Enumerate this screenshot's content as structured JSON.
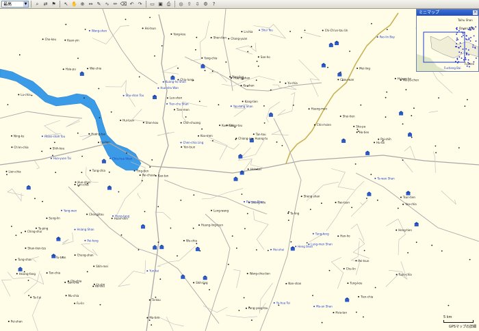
{
  "toolbar": {
    "zoom_select": "最高",
    "buttons": [
      "find-icon",
      "route-icon",
      "waypoint-icon",
      "select-icon",
      "pan-icon",
      "zoom-icon",
      "measure-icon",
      "draw-icon",
      "track-icon",
      "pencil-icon",
      "erase-icon",
      "undo-icon",
      "redo-icon",
      "folder-icon",
      "save-icon",
      "print-icon",
      "gps-icon",
      "upload-icon",
      "download-icon",
      "settings-icon",
      "help-icon"
    ]
  },
  "minimap": {
    "title": "ミニマップ",
    "close_label": "×",
    "labels": [
      "Taihu Shan",
      "Dayan Wan",
      "Fucheng Bai",
      "Fuzhen"
    ]
  },
  "scale": {
    "label": "5 km"
  },
  "detail": {
    "label": "GPSマップの詳細"
  },
  "colors": {
    "background": "#fffce8",
    "water": "#3b9be6",
    "road": "#a9a9a9",
    "highway": "#c8b254",
    "poi_blue": "#1e3cc8"
  },
  "map": {
    "black_labels": [
      "Chongjitou",
      "Hui-tsun",
      "Sheng-shan",
      "Shan-tien-tzu",
      "Chi-chia",
      "Huang-tu",
      "Chi-Ch'un-tzu Un",
      "Hsia-tan",
      "Huang-shan",
      "Hsiang-fang",
      "Pei-tsun",
      "Yu-tsun",
      "Hu-tai",
      "Cho-kou",
      "Fang-yang-tzu",
      "Ta-ling",
      "Tan-chia",
      "Wang-chia-tien",
      "Huang-ling-tsun",
      "Shih-kou",
      "San-ho",
      "Kuei-hua",
      "Tung-chia",
      "Yu-chia",
      "Lu-chia",
      "Huang-tse",
      "Chiang-an",
      "Lien-chia",
      "Kou-men",
      "Ning-ku",
      "Chin-hsien",
      "Shih-mei",
      "Ta-t'ai",
      "Pai-chuan",
      "Tuan-chia",
      "Huan-shih",
      "Chang-yuan",
      "Ma-yu-chen",
      "Hsi-tsun",
      "Huo-shan",
      "Shui-tien",
      "Pei-shan",
      "Nan-shan",
      "Huang-men",
      "Tung-shan",
      "Yang-kou",
      "Chiu-lung",
      "Ta-ping",
      "Ko-shu",
      "Tien-chia",
      "Shih-ling",
      "Liu-ho",
      "Hsin-kai",
      "Luo-shan",
      "Wu-chia",
      "Chu-lin",
      "Ho-tien",
      "Mu-chia",
      "Tsai-chia",
      "Sung-lin",
      "Kuan-yin",
      "Chih-chuang",
      "Hsia-pu",
      "Pai-shih",
      "Tan-tou",
      "Chou-wan",
      "Li-chia",
      "Kao-tan",
      "Heng-tien",
      "Fu-lin",
      "Ku-shan",
      "Shan-kou",
      "Han-ho",
      "Ching-shui",
      "Tsun-tien",
      "Wei-chia",
      "Sha-pa",
      "Lan-chia",
      "Tung-kou",
      "Shen-tien",
      "Chung-shan",
      "Lo-tien",
      "Mei-ling",
      "Ta-kou",
      "Chiao-tou",
      "Ma-tien",
      "Hsiang-ho",
      "Yao-chia",
      "Lung-wang",
      "Ting-tien",
      "Pao-tsun",
      "Kang-tien",
      "Shang-kou",
      "Ch'en-chia",
      "Ping-ling",
      "Yen-tsun",
      "Tien-men",
      "Yang-chia"
    ],
    "blue_labels": [
      "Shu-shan Tou",
      "Pao-lin Bay",
      "Wang-shan",
      "Yang-wan",
      "Hung-tang",
      "Chen-chia Ling",
      "Hsiang Shan",
      "Yen-tang Shan",
      "Tung-feng",
      "Pai-yun Shan",
      "Huo-sha Wan",
      "Heng Shan",
      "Hei-shui",
      "Ta-wan Shan",
      "Ma-an Shan",
      "Tien-chu Shan",
      "Yu-hua Tai",
      "Shui Tou",
      "Kuang-ho Shan",
      "Chiu-hua Shan",
      "Hsiao-shan Tou",
      "Pei-feng",
      "Lung-men Shan",
      "Yun-tai",
      "Hua-yuan Tai"
    ]
  }
}
